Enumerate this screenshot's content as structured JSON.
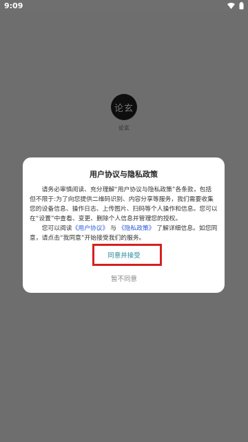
{
  "status_bar": {
    "time": "9:09",
    "icons": [
      "wifi-icon",
      "battery-icon"
    ]
  },
  "splash": {
    "logo_text": "论玄",
    "app_name": "论玄"
  },
  "dialog": {
    "title": "用户协议与隐私政策",
    "para1": "请务必审慎阅读、充分理解“用户协议与隐私政策”各条款，包括但不限于:为了向您提供二维码识别、内容分享等服务，我们需要收集您的设备信息、操作日志、上传图片、扫码等个人操作和信息。您可以在“设置”中查看、变更、删除个人信息并管理您的授权。",
    "para2_prefix": "您可以阅读",
    "user_agreement_link": "《用户协议》",
    "and_text": " 与 ",
    "privacy_policy_link": "《隐私政策》",
    "para2_suffix": " 了解详细信息。如您同意，请点击“我同意”开始接受我们的服务。",
    "accept_label": "同意并接受",
    "decline_label": "暂不同意"
  },
  "colors": {
    "link": "#2a5ad8",
    "accept_text": "#2a8a9a",
    "highlight_border": "#d81f1f",
    "overlay": "rgba(0,0,0,0.55)"
  }
}
